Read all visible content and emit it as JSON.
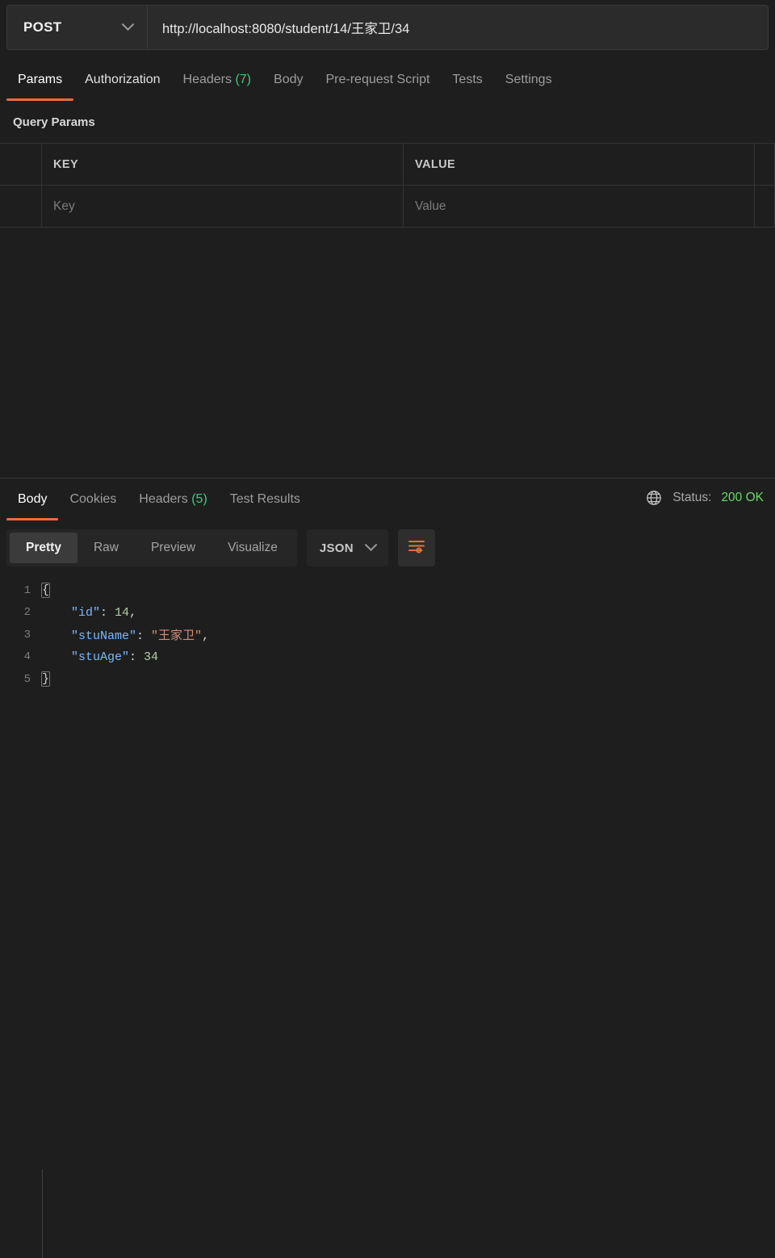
{
  "request": {
    "method": "POST",
    "method_icon": "chevron-down-icon",
    "url": "http://localhost:8080/student/14/王家卫/34",
    "url_placeholder": "Enter request URL",
    "tabs": [
      {
        "label": "Params",
        "count": null,
        "active": true
      },
      {
        "label": "Authorization",
        "count": null,
        "active": false
      },
      {
        "label": "Headers",
        "count": "(7)",
        "active": false
      },
      {
        "label": "Body",
        "count": null,
        "active": false
      },
      {
        "label": "Pre-request Script",
        "count": null,
        "active": false
      },
      {
        "label": "Tests",
        "count": null,
        "active": false
      },
      {
        "label": "Settings",
        "count": null,
        "active": false
      }
    ]
  },
  "query_params": {
    "section_title": "Query Params",
    "columns": [
      "KEY",
      "VALUE",
      ""
    ],
    "rows": [
      {
        "key_placeholder": "Key",
        "value_placeholder": "Value"
      }
    ]
  },
  "response": {
    "tabs": [
      {
        "label": "Body",
        "count": null,
        "active": true
      },
      {
        "label": "Cookies",
        "count": null,
        "active": false
      },
      {
        "label": "Headers",
        "count": "(5)",
        "active": false
      },
      {
        "label": "Test Results",
        "count": null,
        "active": false
      }
    ],
    "globe_icon": "globe-icon",
    "status_label": "Status:",
    "status_code": "200 OK",
    "format_buttons": [
      {
        "label": "Pretty",
        "active": true
      },
      {
        "label": "Raw",
        "active": false
      },
      {
        "label": "Preview",
        "active": false
      },
      {
        "label": "Visualize",
        "active": false
      }
    ],
    "language": "JSON",
    "language_icon": "chevron-down-icon",
    "wrap_icon": "word-wrap-icon",
    "body_lines": [
      {
        "num": "1",
        "tokens": [
          {
            "t": "{",
            "c": "brace"
          }
        ]
      },
      {
        "num": "2",
        "tokens": [
          {
            "t": "    ",
            "c": "punc"
          },
          {
            "t": "\"id\"",
            "c": "key"
          },
          {
            "t": ": ",
            "c": "punc"
          },
          {
            "t": "14",
            "c": "num"
          },
          {
            "t": ",",
            "c": "punc"
          }
        ]
      },
      {
        "num": "3",
        "tokens": [
          {
            "t": "    ",
            "c": "punc"
          },
          {
            "t": "\"stuName\"",
            "c": "key"
          },
          {
            "t": ": ",
            "c": "punc"
          },
          {
            "t": "\"王家卫\"",
            "c": "str"
          },
          {
            "t": ",",
            "c": "punc"
          }
        ]
      },
      {
        "num": "4",
        "tokens": [
          {
            "t": "    ",
            "c": "punc"
          },
          {
            "t": "\"stuAge\"",
            "c": "key"
          },
          {
            "t": ": ",
            "c": "punc"
          },
          {
            "t": "34",
            "c": "num"
          }
        ]
      },
      {
        "num": "5",
        "tokens": [
          {
            "t": "}",
            "c": "brace"
          }
        ]
      }
    ]
  },
  "colors": {
    "accent": "#f26b3a",
    "success": "#43c97f",
    "status_green": "#6bd968",
    "json_key": "#79b8ff",
    "json_string": "#ce9178",
    "json_number": "#b5cea8",
    "background": "#1e1e1e"
  }
}
